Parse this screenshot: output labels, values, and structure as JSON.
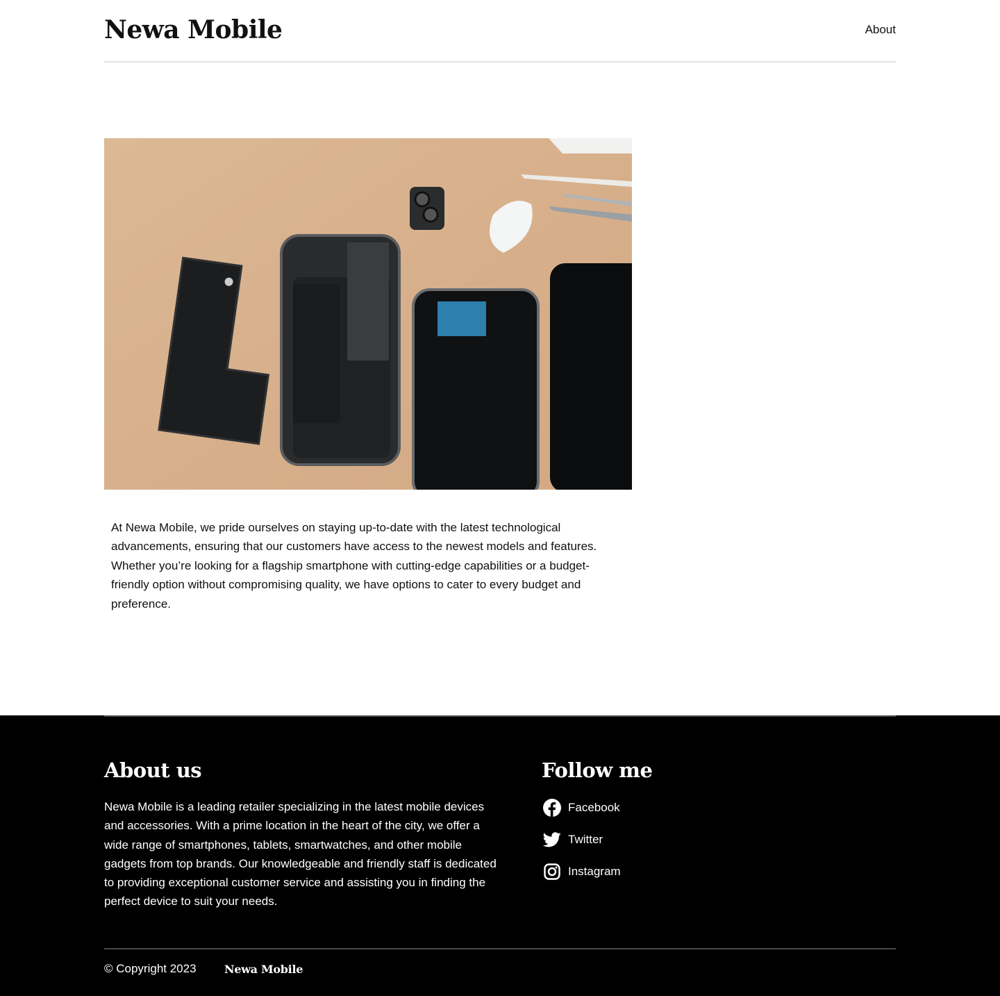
{
  "header": {
    "brand": "Newa Mobile",
    "nav": {
      "about_label": "About"
    }
  },
  "main": {
    "hero_image": {
      "icon": "disassembled-phone-photo"
    },
    "intro_text": "At Newa Mobile, we pride ourselves on staying up-to-date with the latest technological advancements, ensuring that our customers have access to the newest models and features. Whether you’re looking for a flagship smartphone with cutting-edge capabilities or a budget-friendly option without compromising quality, we have options to cater to every budget and preference."
  },
  "footer": {
    "about": {
      "title": "About us",
      "text": "Newa Mobile is a leading retailer specializing in the latest mobile devices and accessories. With a prime location in the heart of the city, we offer a wide range of smartphones, tablets, smartwatches, and other mobile gadgets from top brands. Our knowledgeable and friendly staff is dedicated to providing exceptional customer service and assisting you in finding the perfect device to suit your needs."
    },
    "follow": {
      "title": "Follow me",
      "links": [
        {
          "label": "Facebook",
          "icon": "facebook-icon"
        },
        {
          "label": "Twitter",
          "icon": "twitter-icon"
        },
        {
          "label": "Instagram",
          "icon": "instagram-icon"
        }
      ]
    },
    "copyright": "© Copyright 2023",
    "brand": "Newa Mobile"
  },
  "colors": {
    "background": "#ffffff",
    "footer_background": "#000000",
    "text": "#111111",
    "footer_text": "#ffffff",
    "divider": "#e4e4e4"
  }
}
